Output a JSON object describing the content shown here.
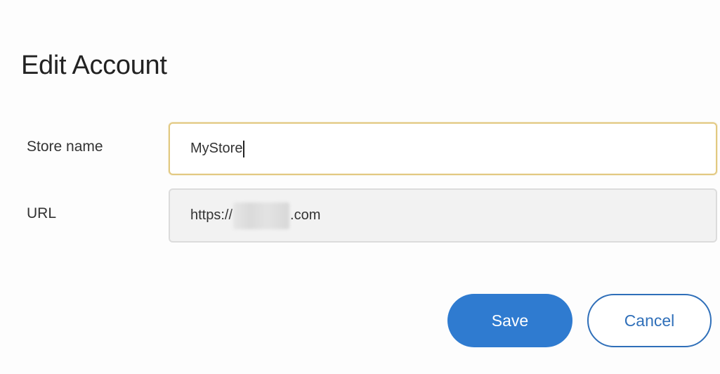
{
  "dialog": {
    "title": "Edit Account"
  },
  "form": {
    "store_name": {
      "label": "Store name",
      "value": "MyStore"
    },
    "url": {
      "label": "URL",
      "prefix": "https://",
      "suffix": ".com"
    }
  },
  "actions": {
    "save_label": "Save",
    "cancel_label": "Cancel"
  },
  "colors": {
    "primary": "#2f7bd0",
    "focus_border": "#e2c981",
    "disabled_bg": "#f2f2f2"
  }
}
